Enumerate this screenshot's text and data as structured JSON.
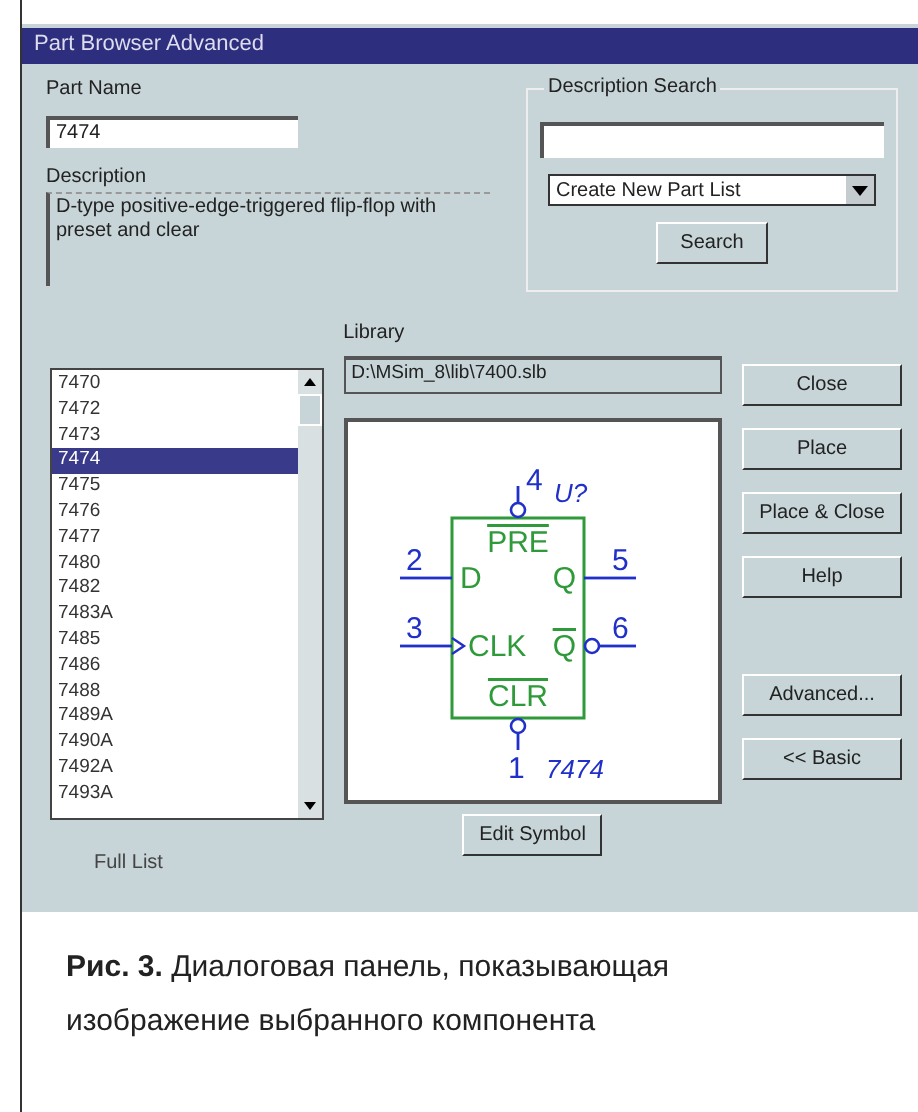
{
  "window": {
    "title": "Part Browser Advanced"
  },
  "part_name": {
    "label": "Part Name",
    "value": "7474"
  },
  "description": {
    "label": "Description",
    "text": "D-type positive-edge-triggered flip-flop with preset and clear"
  },
  "description_search": {
    "label": "Description Search",
    "dropdown": "Create New Part List",
    "button": "Search"
  },
  "parts": [
    {
      "label": "7470",
      "selected": false
    },
    {
      "label": "7472",
      "selected": false
    },
    {
      "label": "7473",
      "selected": false
    },
    {
      "label": "7474",
      "selected": true
    },
    {
      "label": "7475",
      "selected": false
    },
    {
      "label": "7476",
      "selected": false
    },
    {
      "label": "7477",
      "selected": false
    },
    {
      "label": "7480",
      "selected": false
    },
    {
      "label": "7482",
      "selected": false
    },
    {
      "label": "7483A",
      "selected": false
    },
    {
      "label": "7485",
      "selected": false
    },
    {
      "label": "7486",
      "selected": false
    },
    {
      "label": "7488",
      "selected": false
    },
    {
      "label": "7489A",
      "selected": false
    },
    {
      "label": "7490A",
      "selected": false
    },
    {
      "label": "7492A",
      "selected": false
    },
    {
      "label": "7493A",
      "selected": false
    }
  ],
  "library": {
    "label": "Library",
    "path": "D:\\MSim_8\\lib\\7400.slb"
  },
  "symbol": {
    "reference": "U?",
    "value": "7474",
    "top_pins": [
      {
        "number": "4",
        "name": "PRE",
        "bubble": true,
        "overbar": true,
        "clock": false
      }
    ],
    "left_pins": [
      {
        "number": "2",
        "name": "D",
        "bubble": false,
        "overbar": false,
        "clock": false
      },
      {
        "number": "3",
        "name": "CLK",
        "bubble": false,
        "overbar": false,
        "clock": true
      }
    ],
    "right_pins": [
      {
        "number": "5",
        "name": "Q",
        "bubble": false,
        "overbar": false,
        "clock": false
      },
      {
        "number": "6",
        "name": "Q",
        "bubble": true,
        "overbar": true,
        "clock": false
      }
    ],
    "bottom_pins": [
      {
        "number": "1",
        "name": "CLR",
        "bubble": true,
        "overbar": true,
        "clock": false
      }
    ]
  },
  "buttons": [
    "Close",
    "Place",
    "Place & Close",
    "Help",
    "Advanced...",
    "<< Basic"
  ],
  "edit_button": "Edit Symbol",
  "footer_label": "Full List",
  "caption": {
    "text": "**Рис. 3.** Диалоговая панель, показывающая изображение выбранного компонента"
  }
}
